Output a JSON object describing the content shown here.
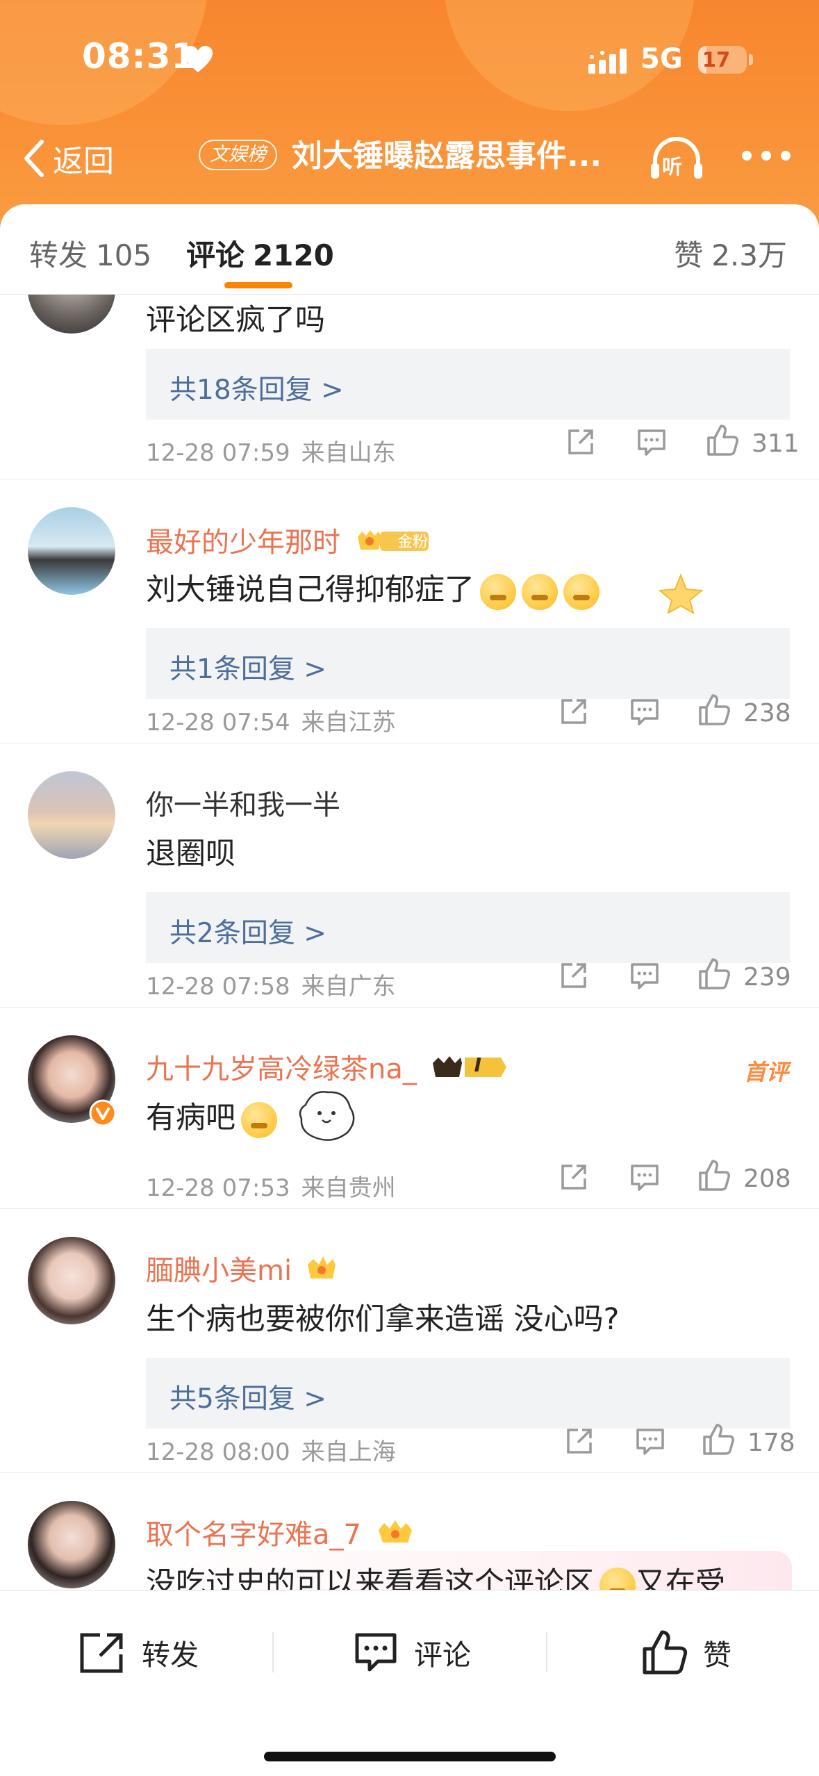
{
  "status_bar": {
    "time": "08:31",
    "network": "5G",
    "battery_level": "17"
  },
  "nav": {
    "back_label": "返回",
    "badge": "文娱榜",
    "title": "刘大锤曝赵露思事件...",
    "listen_label": "听"
  },
  "tabs": {
    "repost_label": "转发",
    "repost_count": "105",
    "comment_label": "评论",
    "comment_count": "2120",
    "likes_label": "赞",
    "likes_count": "2.3万"
  },
  "comments": [
    {
      "text": "评论区疯了吗",
      "replies": "共18条回复 >",
      "date": "12-28 07:59",
      "location": "来自山东",
      "likes": "311"
    },
    {
      "username": "最好的少年那时",
      "fan_badge": "金粉2",
      "text": "刘大锤说自己得抑郁症了",
      "replies": "共1条回复 >",
      "date": "12-28 07:54",
      "location": "来自江苏",
      "likes": "238"
    },
    {
      "username": "你一半和我一半",
      "text": "退圈呗",
      "replies": "共2条回复 >",
      "date": "12-28 07:58",
      "location": "来自广东",
      "likes": "239"
    },
    {
      "username": "九十九岁高冷绿茶na_",
      "level_badge": "I",
      "first_label": "首评",
      "text": "有病吧",
      "date": "12-28 07:53",
      "location": "来自贵州",
      "likes": "208"
    },
    {
      "username": "腼腆小美mi",
      "text": "生个病也要被你们拿来造谣 没心吗?",
      "replies": "共5条回复 >",
      "date": "12-28 08:00",
      "location": "来自上海",
      "likes": "178"
    },
    {
      "username": "取个名字好难a_7",
      "text_before": "没吃过史的可以来看看这个评论区",
      "text_after": "又在受"
    }
  ],
  "bottom_bar": {
    "repost_label": "转发",
    "comment_label": "评论",
    "like_label": "赞"
  },
  "colors": {
    "brand_orange": "#ff8200",
    "username": "#eb7350",
    "link_blue": "#4d6d9a",
    "meta_gray": "#9a9a9a"
  }
}
